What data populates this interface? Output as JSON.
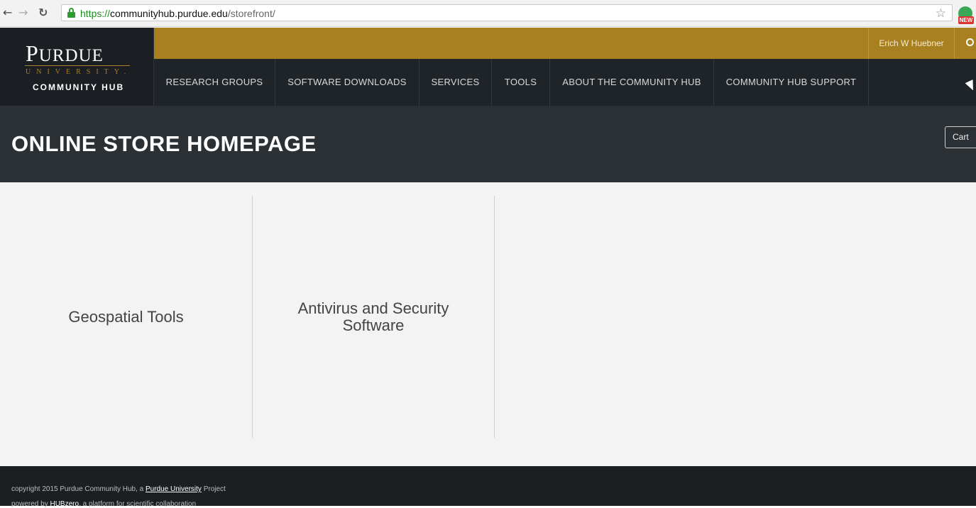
{
  "browser": {
    "url_scheme": "https://",
    "url_host": "communityhub.purdue.edu",
    "url_path": "/storefront/",
    "extension_badge": "NEW"
  },
  "header": {
    "logo_big_p": "P",
    "logo_rest": "URDUE",
    "logo_university": "UNIVERSITY.",
    "logo_subtitle": "COMMUNITY HUB",
    "user_name": "Erich W Huebner",
    "nav_items": [
      "RESEARCH GROUPS",
      "SOFTWARE DOWNLOADS",
      "SERVICES",
      "TOOLS",
      "ABOUT THE COMMUNITY HUB",
      "COMMUNITY HUB SUPPORT"
    ]
  },
  "page": {
    "title": "ONLINE STORE HOMEPAGE",
    "cart_label": "Cart"
  },
  "categories": [
    "Geospatial Tools",
    "Antivirus and Security Software"
  ],
  "footer": {
    "line1_prefix": "copyright 2015 Purdue Community Hub, a ",
    "line1_link": "Purdue University",
    "line1_suffix": " Project",
    "line2_prefix": "powered by ",
    "line2_link": "HUBzero",
    "line2_suffix": ", a platform for scientific collaboration"
  },
  "colors": {
    "gold": "#a8801f",
    "header_dark": "#1f2429",
    "title_band": "#2b3035",
    "content_bg": "#f3f3f3"
  }
}
